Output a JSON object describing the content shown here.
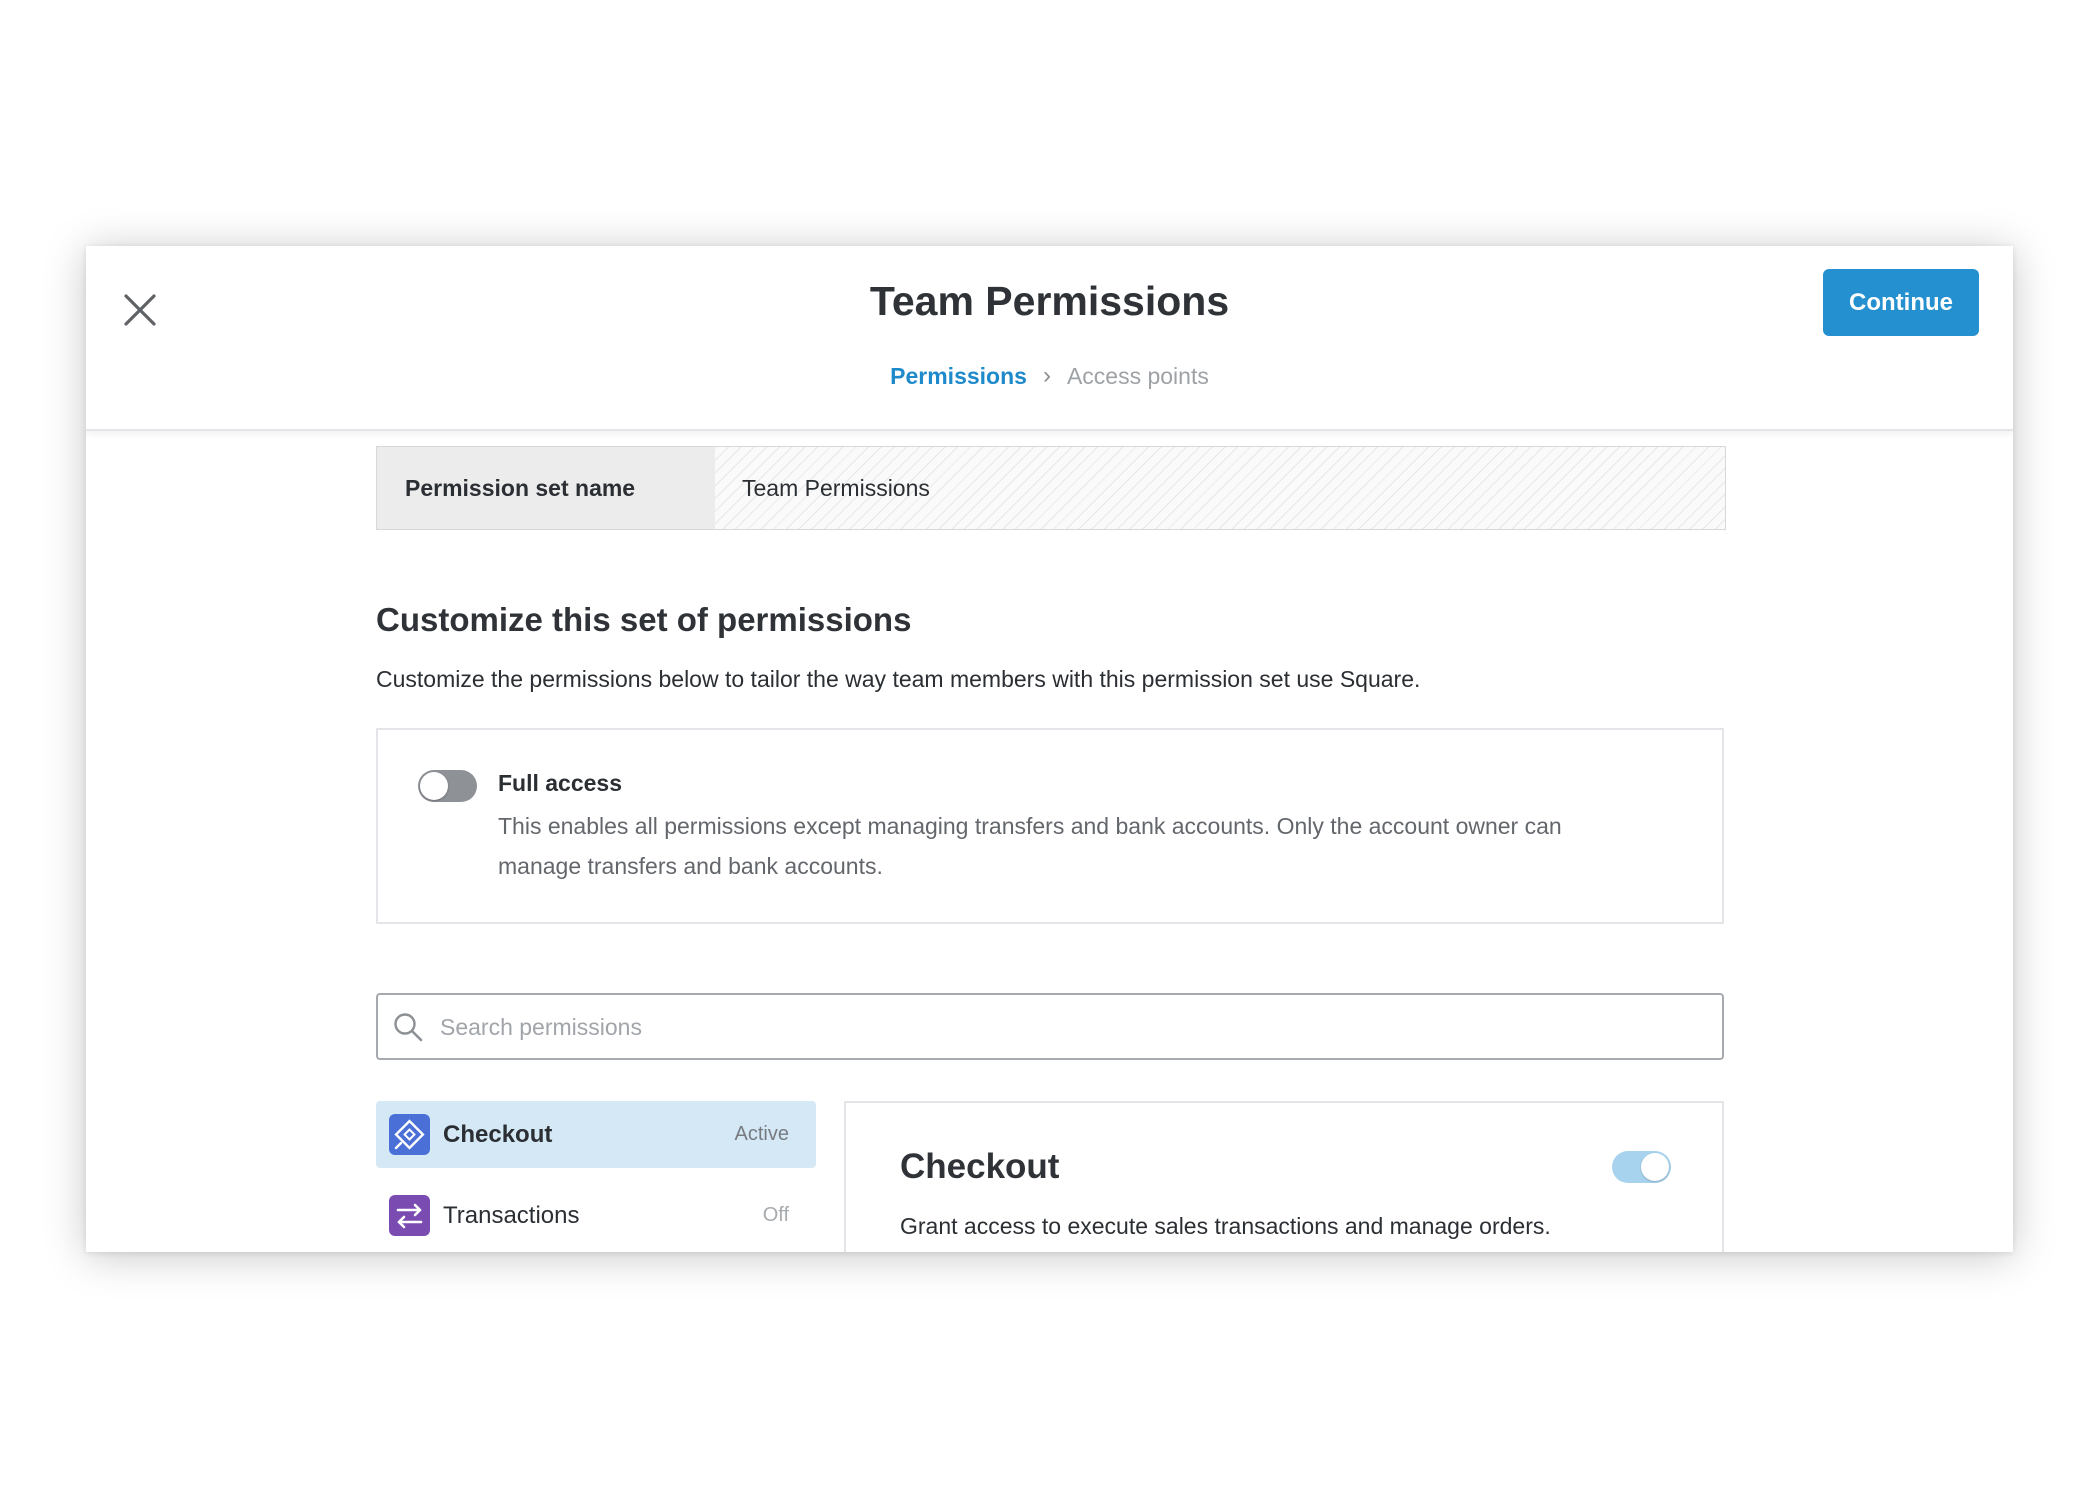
{
  "header": {
    "title": "Team Permissions",
    "continue_label": "Continue",
    "close_icon": "close-icon",
    "breadcrumb": {
      "current": "Permissions",
      "separator": "›",
      "next": "Access points"
    }
  },
  "permission_set": {
    "label": "Permission set name",
    "value": "Team Permissions"
  },
  "customize": {
    "title": "Customize this set of permissions",
    "description": "Customize the permissions below to tailor the way team members with this permission set use Square."
  },
  "full_access": {
    "enabled": false,
    "title": "Full access",
    "description": "This enables all permissions except managing transfers and bank accounts. Only the account owner can manage transfers and bank accounts."
  },
  "search": {
    "placeholder": "Search permissions",
    "value": ""
  },
  "permissions": [
    {
      "label": "Checkout",
      "status": "Active",
      "icon": "checkout-icon",
      "icon_color": "#4a6fd6",
      "selected": true
    },
    {
      "label": "Transactions",
      "status": "Off",
      "icon": "transactions-icon",
      "icon_color": "#7a4bb0",
      "selected": false
    }
  ],
  "detail": {
    "title": "Checkout",
    "enabled": true,
    "description": "Grant access to execute sales transactions and manage orders."
  },
  "colors": {
    "accent": "#2490cf",
    "link": "#1f8acb",
    "selected_bg": "#d4e8f6",
    "toggle_on": "#a8d3ee",
    "toggle_off": "#8e9297"
  }
}
